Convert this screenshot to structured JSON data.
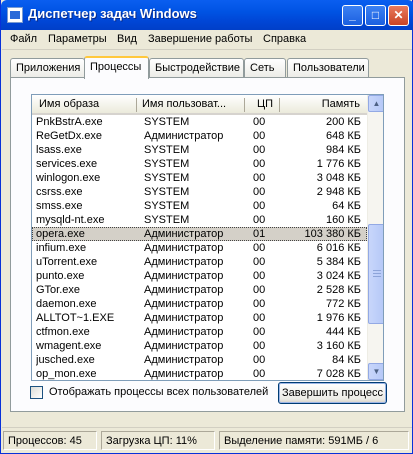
{
  "window": {
    "title": "Диспетчер задач Windows",
    "icon": "task-manager-icon"
  },
  "menu": [
    "Файл",
    "Параметры",
    "Вид",
    "Завершение работы",
    "Справка"
  ],
  "tabs": [
    "Приложения",
    "Процессы",
    "Быстродействие",
    "Сеть",
    "Пользователи"
  ],
  "active_tab": "Процессы",
  "columns": [
    "Имя образа",
    "Имя пользоват...",
    "ЦП",
    "Память"
  ],
  "processes": [
    {
      "name": "PnkBstrA.exe",
      "user": "SYSTEM",
      "cpu": "00",
      "mem": "200 КБ"
    },
    {
      "name": "ReGetDx.exe",
      "user": "Администратор",
      "cpu": "00",
      "mem": "648 КБ"
    },
    {
      "name": "lsass.exe",
      "user": "SYSTEM",
      "cpu": "00",
      "mem": "984 КБ"
    },
    {
      "name": "services.exe",
      "user": "SYSTEM",
      "cpu": "00",
      "mem": "1 776 КБ"
    },
    {
      "name": "winlogon.exe",
      "user": "SYSTEM",
      "cpu": "00",
      "mem": "3 048 КБ"
    },
    {
      "name": "csrss.exe",
      "user": "SYSTEM",
      "cpu": "00",
      "mem": "2 948 КБ"
    },
    {
      "name": "smss.exe",
      "user": "SYSTEM",
      "cpu": "00",
      "mem": "64 КБ"
    },
    {
      "name": "mysqld-nt.exe",
      "user": "SYSTEM",
      "cpu": "00",
      "mem": "160 КБ"
    },
    {
      "name": "opera.exe",
      "user": "Администратор",
      "cpu": "01",
      "mem": "103 380 КБ"
    },
    {
      "name": "infium.exe",
      "user": "Администратор",
      "cpu": "00",
      "mem": "6 016 КБ"
    },
    {
      "name": "uTorrent.exe",
      "user": "Администратор",
      "cpu": "00",
      "mem": "5 384 КБ"
    },
    {
      "name": "punto.exe",
      "user": "Администратор",
      "cpu": "00",
      "mem": "3 024 КБ"
    },
    {
      "name": "GTor.exe",
      "user": "Администратор",
      "cpu": "00",
      "mem": "2 528 КБ"
    },
    {
      "name": "daemon.exe",
      "user": "Администратор",
      "cpu": "00",
      "mem": "772 КБ"
    },
    {
      "name": "ALLTOT~1.EXE",
      "user": "Администратор",
      "cpu": "00",
      "mem": "1 976 КБ"
    },
    {
      "name": "ctfmon.exe",
      "user": "Администратор",
      "cpu": "00",
      "mem": "444 КБ"
    },
    {
      "name": "wmagent.exe",
      "user": "Администратор",
      "cpu": "00",
      "mem": "3 160 КБ"
    },
    {
      "name": "jusched.exe",
      "user": "Администратор",
      "cpu": "00",
      "mem": "84 КБ"
    },
    {
      "name": "op_mon.exe",
      "user": "Администратор",
      "cpu": "00",
      "mem": "7 028 КБ"
    }
  ],
  "selected_process": "opera.exe",
  "show_all_label": "Отображать процессы всех пользователей",
  "show_all_checked": false,
  "end_process_label": "Завершить процесс",
  "status": {
    "processes": "Процессов: 45",
    "cpu": "Загрузка ЦП: 11%",
    "memory": "Выделение памяти: 591МБ / 6"
  },
  "colors": {
    "titlebar": "#0053e3",
    "active_tab_accent": "#ffc83c",
    "selection": "#d4d0c8"
  }
}
